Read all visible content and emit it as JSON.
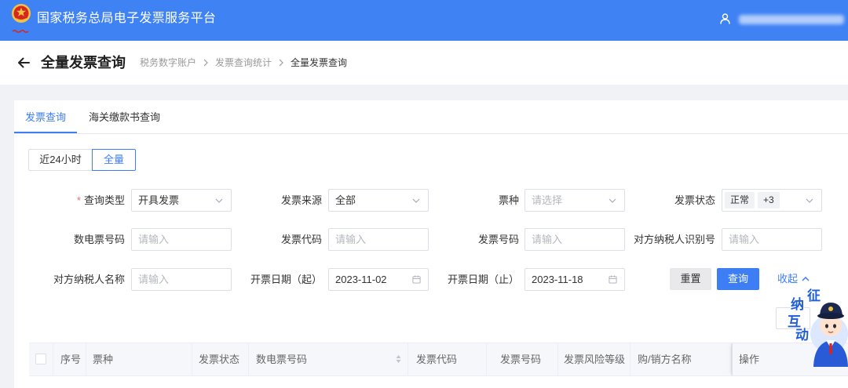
{
  "header": {
    "title": "国家税务总局电子发票服务平台"
  },
  "page": {
    "title": "全量发票查询",
    "breadcrumb": [
      "税务数字账户",
      "发票查询统计",
      "全量发票查询"
    ]
  },
  "tabs": [
    {
      "label": "发票查询",
      "active": true
    },
    {
      "label": "海关缴款书查询",
      "active": false
    }
  ],
  "range_toggle": [
    {
      "label": "近24小时",
      "selected": false
    },
    {
      "label": "全量",
      "selected": true
    }
  ],
  "form": {
    "query_type": {
      "label": "查询类型",
      "required_mark": "*",
      "value": "开具发票"
    },
    "invoice_source": {
      "label": "发票来源",
      "value": "全部"
    },
    "invoice_kind": {
      "label": "票种",
      "placeholder": "请选择"
    },
    "invoice_status": {
      "label": "发票状态",
      "tags": [
        "正常",
        "+3"
      ]
    },
    "digital_invoice_no": {
      "label": "数电票号码",
      "placeholder": "请输入"
    },
    "invoice_code": {
      "label": "发票代码",
      "placeholder": "请输入"
    },
    "invoice_no": {
      "label": "发票号码",
      "placeholder": "请输入"
    },
    "counterparty_tax_id": {
      "label": "对方纳税人识别号",
      "placeholder": "请输入"
    },
    "counterparty_name": {
      "label": "对方纳税人名称",
      "placeholder": "请输入"
    },
    "date_start": {
      "label": "开票日期（起）",
      "value": "2023-11-02"
    },
    "date_end": {
      "label": "开票日期（止）",
      "value": "2023-11-18"
    }
  },
  "actions": {
    "reset": "重置",
    "search": "查询",
    "collapse": "收起"
  },
  "table": {
    "select_all_checked": false,
    "columns": [
      "序号",
      "票种",
      "发票状态",
      "数电票号码",
      "发票代码",
      "发票号码",
      "发票风险等级",
      "购/销方名称",
      "操作"
    ]
  },
  "mascot": {
    "chars": [
      "征",
      "纳",
      "互",
      "动"
    ]
  },
  "colors": {
    "header_bg": "#3f82f4",
    "primary": "#3d7ef5",
    "required_mark": "#f56c6c",
    "page_bg": "#f0f2f5"
  },
  "icons": {
    "logo": "national-emblem-logo",
    "user": "user-icon",
    "back": "back-arrow-icon",
    "breadcrumb_separator": "chevron-right-icon",
    "select": "chevron-down-icon",
    "date": "calendar-icon",
    "collapse": "chevron-up-icon",
    "sort": "sort-icon"
  }
}
